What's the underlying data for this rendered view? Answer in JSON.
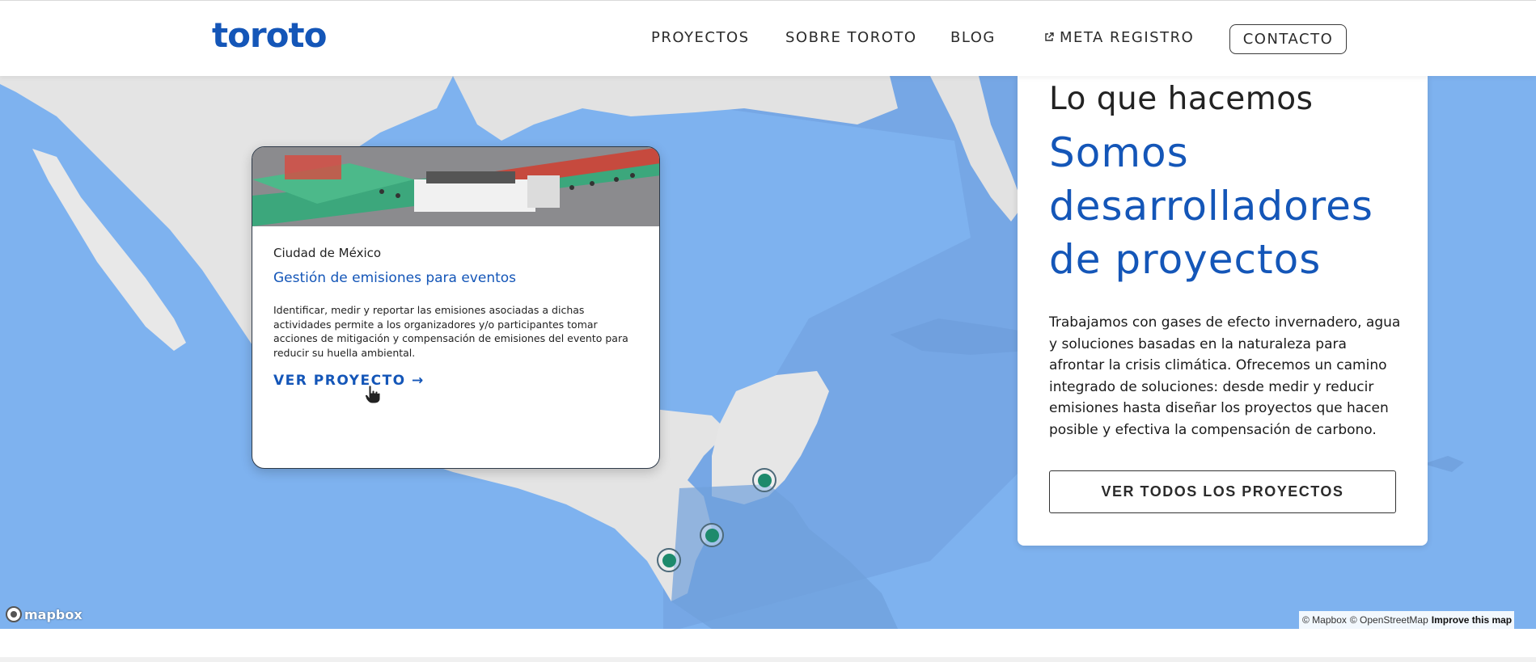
{
  "header": {
    "logo": "toroto",
    "nav": [
      {
        "label": "PROYECTOS"
      },
      {
        "label": "SOBRE TOROTO"
      },
      {
        "label": "BLOG"
      },
      {
        "label": "META REGISTRO",
        "icon": "external-link-icon"
      }
    ],
    "contact_label": "CONTACTO"
  },
  "map": {
    "provider_logo": "mapbox",
    "attribution": {
      "mapbox": "© Mapbox",
      "osm": "© OpenStreetMap",
      "improve": "Improve this map"
    },
    "markers": 3
  },
  "card": {
    "city": "Ciudad de México",
    "title": "Gestión de emisiones para eventos",
    "description": "Identificar, medir y reportar las emisiones asociadas a dichas actividades permite a los organizadores y/o participantes tomar acciones de mitigación y compensación de emisiones del evento para reducir su huella ambiental.",
    "link_label": "VER PROYECTO →"
  },
  "panel": {
    "kicker": "Lo que hacemos",
    "title": "Somos desarrolladores de proyectos",
    "text": "Trabajamos con gases de efecto invernadero, agua y soluciones basadas en la naturaleza para afrontar la crisis climática. Ofrecemos un camino integrado de soluciones: desde medir y reducir emisiones hasta diseñar los proyectos que hacen posible y efectiva la compensación de carbono.",
    "button_label": "VER TODOS LOS PROYECTOS"
  },
  "colors": {
    "brand_blue": "#1456b8",
    "ocean": "#7eb2ef",
    "land": "#e6e6e6",
    "marker_green": "#1e8a6c"
  }
}
